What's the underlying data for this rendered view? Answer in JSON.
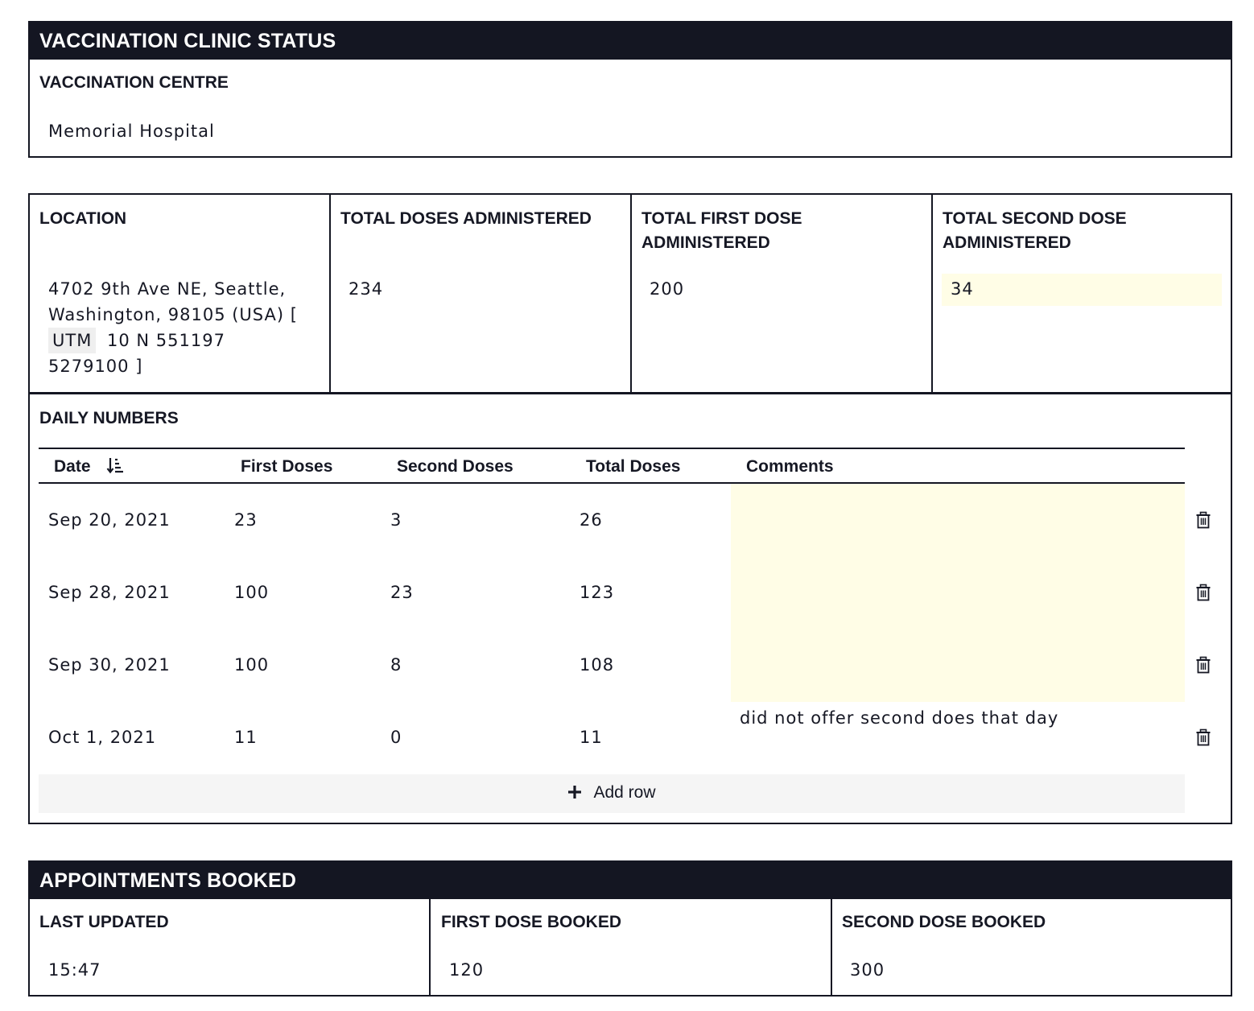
{
  "clinic_status": {
    "header": "VACCINATION CLINIC STATUS",
    "centre_label": "VACCINATION CENTRE",
    "centre_value": "Memorial Hospital"
  },
  "summary": {
    "location_label": "LOCATION",
    "location_address_line1": "4702 9th Ave NE, Seattle,",
    "location_address_line2": "Washington, 98105 (USA) [",
    "location_utm_tag": "UTM",
    "location_utm_value": "10 N 551197",
    "location_utm_northing": "5279100 ]",
    "total_doses_label": "TOTAL DOSES ADMINISTERED",
    "total_doses_value": "234",
    "first_dose_label_line1": "TOTAL FIRST DOSE",
    "first_dose_label_line2": "ADMINISTERED",
    "first_dose_value": "200",
    "second_dose_label_line1": "TOTAL SECOND DOSE",
    "second_dose_label_line2": "ADMINISTERED",
    "second_dose_value": "34"
  },
  "daily_numbers": {
    "label": "DAILY NUMBERS",
    "columns": {
      "date": "Date",
      "first": "First Doses",
      "second": "Second Doses",
      "total": "Total Doses",
      "comments": "Comments"
    },
    "rows": [
      {
        "date": "Sep 20, 2021",
        "first": "23",
        "second": "3",
        "total": "26",
        "comment": ""
      },
      {
        "date": "Sep 28, 2021",
        "first": "100",
        "second": "23",
        "total": "123",
        "comment": ""
      },
      {
        "date": "Sep 30, 2021",
        "first": "100",
        "second": "8",
        "total": "108",
        "comment": ""
      },
      {
        "date": "Oct 1, 2021",
        "first": "11",
        "second": "0",
        "total": "11",
        "comment": "did not offer second does that day"
      }
    ],
    "add_row_label": "Add row"
  },
  "appointments": {
    "header": "APPOINTMENTS BOOKED",
    "last_updated_label": "LAST UPDATED",
    "last_updated_value": "15:47",
    "first_booked_label": "FIRST DOSE BOOKED",
    "first_booked_value": "120",
    "second_booked_label": "SECOND DOSE BOOKED",
    "second_booked_value": "300"
  },
  "colors": {
    "header_bg": "#141622",
    "highlight": "#fffde6",
    "add_row_bg": "#f5f5f5"
  }
}
